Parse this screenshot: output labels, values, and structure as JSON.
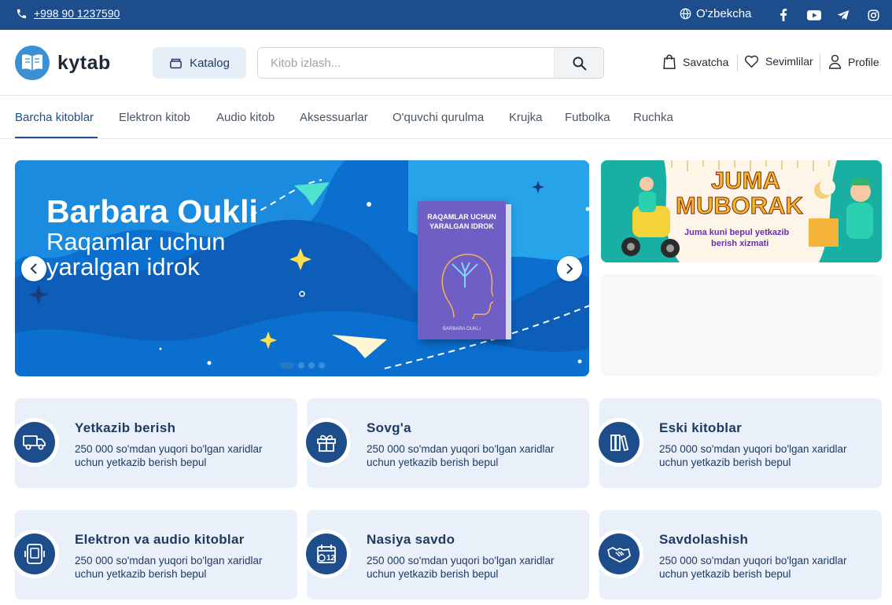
{
  "topbar": {
    "phone": "+998 90 1237590",
    "language": "O'zbekcha",
    "social": [
      "facebook-icon",
      "youtube-icon",
      "telegram-icon",
      "instagram-icon"
    ]
  },
  "header": {
    "logo_text": "kytab",
    "katalog_label": "Katalog",
    "search_placeholder": "Kitob izlash...",
    "cart_label": "Savatcha",
    "favorites_label": "Sevimlilar",
    "profile_label": "Profile"
  },
  "nav": {
    "tabs": [
      "Barcha kitoblar",
      "Elektron kitob",
      "Audio kitob",
      "Aksessuarlar",
      "O'quvchi qurulma",
      "Krujka",
      "Futbolka",
      "Ruchka"
    ],
    "active_index": 0
  },
  "hero": {
    "title": "Barbara Oukli",
    "subtitle_line1": "Raqamlar uchun",
    "subtitle_line2": "yaralgan idrok",
    "book_title": "RAQAMLAR UCHUN YARALGAN IDROK",
    "book_author": "BARBARA OUKLI",
    "slide_count": 4,
    "active_slide": 0
  },
  "promo": {
    "line1": "JUMA",
    "line2": "MUBORAK",
    "line3": "Juma kuni bepul yetkazib",
    "line4": "berish xizmati"
  },
  "features": [
    {
      "icon": "truck-icon",
      "title": "Yetkazib berish",
      "desc": "250 000 so'mdan yuqori bo'lgan xaridlar uchun yetkazib berish bepul"
    },
    {
      "icon": "gift-icon",
      "title": "Sovg'a",
      "desc": "250 000 so'mdan yuqori bo'lgan xaridlar uchun yetkazib berish bepul"
    },
    {
      "icon": "books-icon",
      "title": "Eski kitoblar",
      "desc": "250 000 so'mdan yuqori bo'lgan xaridlar uchun yetkazib berish bepul"
    },
    {
      "icon": "ebook-icon",
      "title": "Elektron va audio kitoblar",
      "desc": "250 000 so'mdan yuqori bo'lgan xaridlar uchun yetkazib berish bepul"
    },
    {
      "icon": "calendar-money-icon",
      "title": "Nasiya savdo",
      "desc": "250 000 so'mdan yuqori bo'lgan xaridlar uchun yetkazib berish bepul"
    },
    {
      "icon": "handshake-icon",
      "title": "Savdolashish",
      "desc": "250 000 so'mdan yuqori bo'lgan xaridlar uchun yetkazib berish bepul"
    }
  ],
  "colors": {
    "primary": "#1e4d8c",
    "card_bg": "#e9f0fa",
    "hero_bg": "#0f79d6",
    "promo_text": "#f6b62a"
  }
}
